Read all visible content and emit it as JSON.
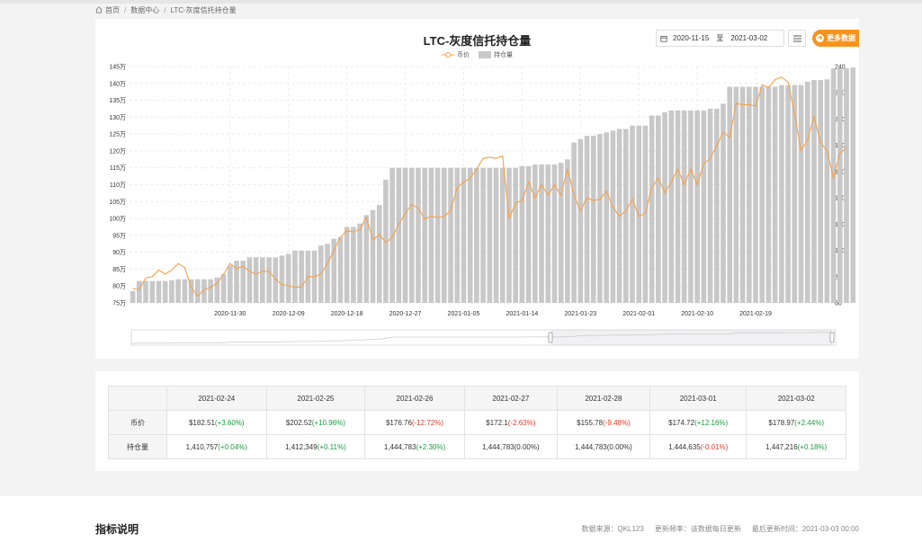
{
  "breadcrumb": [
    "首页",
    "数据中心",
    "LTC-灰度信托持仓量"
  ],
  "controls": {
    "start_date": "2020-11-15",
    "to_label": "至",
    "end_date": "2021-03-02",
    "more_label": "更多数据"
  },
  "colors": {
    "accent": "#f7941d",
    "bar": "#c8c8c8",
    "line": "#f5a04a",
    "up": "#1d9a3f",
    "down": "#e33b2d"
  },
  "chart_data": {
    "type": "bar",
    "title": "LTC-灰度信托持仓量",
    "legend": [
      "币价",
      "持仓量"
    ],
    "legend_position": "top-center",
    "grid": true,
    "x": [
      "2020-11-15",
      "2020-11-16",
      "2020-11-17",
      "2020-11-18",
      "2020-11-19",
      "2020-11-20",
      "2020-11-21",
      "2020-11-22",
      "2020-11-23",
      "2020-11-24",
      "2020-11-25",
      "2020-11-26",
      "2020-11-27",
      "2020-11-28",
      "2020-11-29",
      "2020-11-30",
      "2020-12-01",
      "2020-12-02",
      "2020-12-03",
      "2020-12-04",
      "2020-12-05",
      "2020-12-06",
      "2020-12-07",
      "2020-12-08",
      "2020-12-09",
      "2020-12-10",
      "2020-12-11",
      "2020-12-12",
      "2020-12-13",
      "2020-12-14",
      "2020-12-15",
      "2020-12-16",
      "2020-12-17",
      "2020-12-18",
      "2020-12-19",
      "2020-12-20",
      "2020-12-21",
      "2020-12-22",
      "2020-12-23",
      "2020-12-24",
      "2020-12-25",
      "2020-12-26",
      "2020-12-27",
      "2020-12-28",
      "2020-12-29",
      "2020-12-30",
      "2020-12-31",
      "2021-01-01",
      "2021-01-02",
      "2021-01-03",
      "2021-01-04",
      "2021-01-05",
      "2021-01-06",
      "2021-01-07",
      "2021-01-08",
      "2021-01-09",
      "2021-01-10",
      "2021-01-11",
      "2021-01-12",
      "2021-01-13",
      "2021-01-14",
      "2021-01-15",
      "2021-01-16",
      "2021-01-17",
      "2021-01-18",
      "2021-01-19",
      "2021-01-20",
      "2021-01-21",
      "2021-01-22",
      "2021-01-23",
      "2021-01-24",
      "2021-01-25",
      "2021-01-26",
      "2021-01-27",
      "2021-01-28",
      "2021-01-29",
      "2021-01-30",
      "2021-01-31",
      "2021-02-01",
      "2021-02-02",
      "2021-02-03",
      "2021-02-04",
      "2021-02-05",
      "2021-02-06",
      "2021-02-07",
      "2021-02-08",
      "2021-02-09",
      "2021-02-10",
      "2021-02-11",
      "2021-02-12",
      "2021-02-13",
      "2021-02-14",
      "2021-02-15",
      "2021-02-16",
      "2021-02-17",
      "2021-02-18",
      "2021-02-19",
      "2021-02-20",
      "2021-02-21",
      "2021-02-22",
      "2021-02-23",
      "2021-02-24",
      "2021-02-25",
      "2021-02-26",
      "2021-02-27",
      "2021-02-28",
      "2021-03-01",
      "2021-03-02"
    ],
    "x_tick_labels": [
      "2020-11-30",
      "2020-12-09",
      "2020-12-18",
      "2020-12-27",
      "2021-01-05",
      "2021-01-14",
      "2021-01-23",
      "2021-02-01",
      "2021-02-10",
      "2021-02-19"
    ],
    "y_left": {
      "min": 75,
      "max": 145,
      "ticks": [
        "75万",
        "80万",
        "85万",
        "90万",
        "95万",
        "100万",
        "105万",
        "110万",
        "115万",
        "120万",
        "125万",
        "130万",
        "135万",
        "140万",
        "145万"
      ]
    },
    "y_right": {
      "min": 60,
      "max": 240,
      "ticks": [
        "60",
        "80",
        "100",
        "120",
        "140",
        "160",
        "180",
        "200",
        "220",
        "240"
      ]
    },
    "series": [
      {
        "name": "持仓量",
        "type": "bar",
        "axis": "left",
        "unit": "万",
        "values": [
          78.5,
          81.5,
          81.5,
          81.5,
          81.5,
          81.5,
          81.7,
          82,
          82,
          82,
          82,
          82,
          82,
          82.5,
          83.5,
          86,
          87.5,
          87.5,
          88.5,
          88.5,
          88.5,
          88.5,
          88.5,
          89,
          89.5,
          90.5,
          90.5,
          90.5,
          90.5,
          92,
          92.5,
          94,
          94.5,
          97.5,
          97.5,
          98.5,
          101,
          102.5,
          104,
          111.5,
          115,
          115,
          115,
          115,
          115,
          115,
          115,
          115,
          115,
          115,
          115,
          115,
          115,
          115,
          115,
          115,
          115,
          115,
          115,
          115,
          115.5,
          115.5,
          116,
          116,
          116,
          116,
          116.5,
          117.5,
          122.5,
          123.5,
          124.5,
          124.5,
          125,
          125.5,
          126,
          126.5,
          126.5,
          127.5,
          127.5,
          127.5,
          130.5,
          130.5,
          131.5,
          132,
          132,
          132,
          132,
          132,
          132,
          132.5,
          132.5,
          134,
          139,
          139,
          139,
          139,
          139,
          139,
          139,
          139,
          139.5,
          139.5,
          139.5,
          139.5,
          140.5,
          141,
          141,
          141.2,
          144.4,
          144.5,
          144.5,
          144.7
        ]
      },
      {
        "name": "币价",
        "type": "line",
        "axis": "right",
        "unit": "$",
        "values": [
          71,
          70,
          79,
          80,
          85,
          82,
          85,
          90,
          87,
          72,
          65,
          70,
          72,
          75,
          82,
          90,
          86,
          88,
          84,
          82,
          84,
          84,
          78,
          74,
          73,
          72,
          72,
          80,
          80,
          82,
          90,
          100,
          110,
          115,
          114,
          116,
          125,
          108,
          112,
          106,
          110,
          120,
          128,
          135,
          132,
          124,
          126,
          125,
          126,
          130,
          148,
          152,
          155,
          162,
          170,
          171,
          170,
          172,
          124,
          136,
          138,
          152,
          140,
          150,
          142,
          150,
          142,
          162,
          142,
          130,
          140,
          138,
          139,
          145,
          133,
          126,
          130,
          139,
          126,
          128,
          148,
          155,
          144,
          152,
          162,
          150,
          162,
          150,
          166,
          170,
          180,
          190,
          186,
          212,
          211,
          211,
          210,
          226,
          224,
          230,
          232,
          228,
          204,
          176,
          184,
          202,
          182,
          176,
          155,
          174,
          178
        ]
      }
    ]
  },
  "table": {
    "dates": [
      "2021-02-24",
      "2021-02-25",
      "2021-02-26",
      "2021-02-27",
      "2021-02-28",
      "2021-03-01",
      "2021-03-02"
    ],
    "rows": [
      {
        "label": "币价",
        "cells": [
          {
            "v": "$182.51",
            "c": "(+3.60%)",
            "dir": "up"
          },
          {
            "v": "$202.52",
            "c": "(+10.96%)",
            "dir": "up"
          },
          {
            "v": "$176.76",
            "c": "(-12.72%)",
            "dir": "down"
          },
          {
            "v": "$172.1",
            "c": "(-2.63%)",
            "dir": "down"
          },
          {
            "v": "$155.78",
            "c": "(-9.48%)",
            "dir": "down"
          },
          {
            "v": "$174.72",
            "c": "(+12.16%)",
            "dir": "up"
          },
          {
            "v": "$178.97",
            "c": "(+2.44%)",
            "dir": "up"
          }
        ]
      },
      {
        "label": "持仓量",
        "cells": [
          {
            "v": "1,410,757",
            "c": "(+0.04%)",
            "dir": "up"
          },
          {
            "v": "1,412,349",
            "c": "(+0.11%)",
            "dir": "up"
          },
          {
            "v": "1,444,783",
            "c": "(+2.30%)",
            "dir": "up"
          },
          {
            "v": "1,444,783",
            "c": "(0.00%)",
            "dir": "flat"
          },
          {
            "v": "1,444,783",
            "c": "(0.00%)",
            "dir": "flat"
          },
          {
            "v": "1,444,635",
            "c": "(-0.01%)",
            "dir": "down"
          },
          {
            "v": "1,447,216",
            "c": "(+0.18%)",
            "dir": "up"
          }
        ]
      }
    ]
  },
  "footer": {
    "heading": "指标说明",
    "source": "数据来源：QKL123",
    "frequency": "更新频率：该数据每日更新",
    "last_update": "最后更新时间：2021-03-03 00:00"
  }
}
